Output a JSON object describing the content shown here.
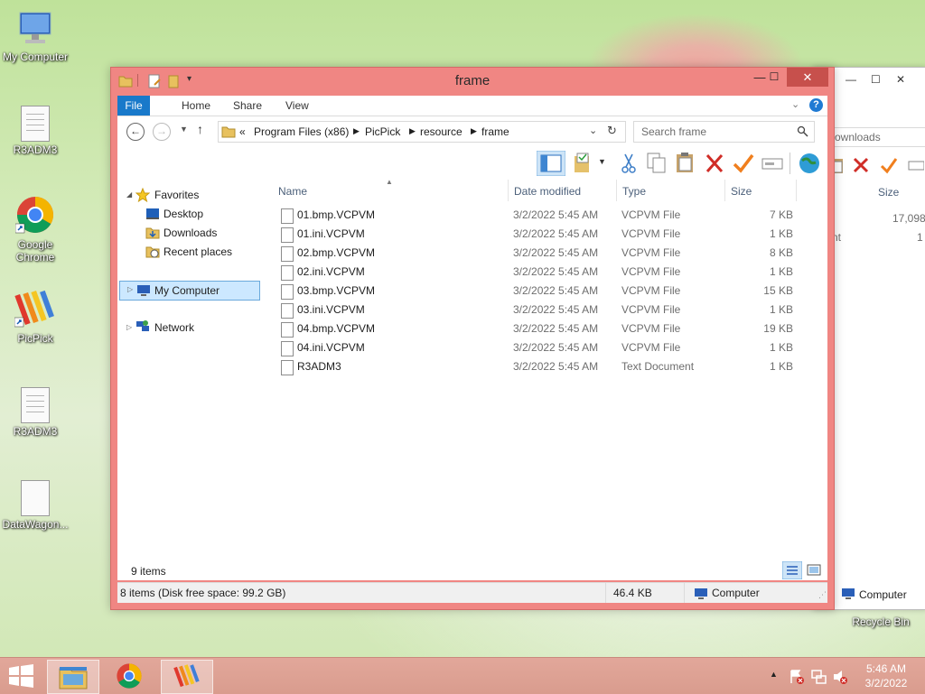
{
  "desktop": {
    "icons": [
      {
        "label": "My Computer"
      },
      {
        "label": "R3ADM3"
      },
      {
        "label": "Google Chrome"
      },
      {
        "label": "PicPick"
      },
      {
        "label": "R3ADM3"
      },
      {
        "label": "DataWagon..."
      },
      {
        "label": "Recycle Bin"
      }
    ]
  },
  "back_window": {
    "address_fragment": "ownloads",
    "col_size": "Size",
    "row1_size": "17,098",
    "row2_fragment": "nt",
    "row2_size": "1",
    "status_computer": "Computer"
  },
  "window": {
    "title": "frame",
    "ribbon_tabs": [
      "File",
      "Home",
      "Share",
      "View"
    ],
    "address": {
      "chevron": "«",
      "crumbs": [
        "Program Files (x86)",
        "PicPick",
        "resource",
        "frame"
      ]
    },
    "search_placeholder": "Search frame",
    "nav": {
      "favorites": "Favorites",
      "desktop": "Desktop",
      "downloads": "Downloads",
      "recent": "Recent places",
      "my_computer": "My Computer",
      "network": "Network"
    },
    "columns": {
      "name": "Name",
      "date": "Date modified",
      "type": "Type",
      "size": "Size"
    },
    "files": [
      {
        "name": "01.bmp.VCPVM",
        "date": "3/2/2022 5:45 AM",
        "type": "VCPVM File",
        "size": "7 KB"
      },
      {
        "name": "01.ini.VCPVM",
        "date": "3/2/2022 5:45 AM",
        "type": "VCPVM File",
        "size": "1 KB"
      },
      {
        "name": "02.bmp.VCPVM",
        "date": "3/2/2022 5:45 AM",
        "type": "VCPVM File",
        "size": "8 KB"
      },
      {
        "name": "02.ini.VCPVM",
        "date": "3/2/2022 5:45 AM",
        "type": "VCPVM File",
        "size": "1 KB"
      },
      {
        "name": "03.bmp.VCPVM",
        "date": "3/2/2022 5:45 AM",
        "type": "VCPVM File",
        "size": "15 KB"
      },
      {
        "name": "03.ini.VCPVM",
        "date": "3/2/2022 5:45 AM",
        "type": "VCPVM File",
        "size": "1 KB"
      },
      {
        "name": "04.bmp.VCPVM",
        "date": "3/2/2022 5:45 AM",
        "type": "VCPVM File",
        "size": "19 KB"
      },
      {
        "name": "04.ini.VCPVM",
        "date": "3/2/2022 5:45 AM",
        "type": "VCPVM File",
        "size": "1 KB"
      },
      {
        "name": "R3ADM3",
        "date": "3/2/2022 5:45 AM",
        "type": "Text Document",
        "size": "1 KB"
      }
    ],
    "item_count": "9 items",
    "status_left": "8 items (Disk free space: 99.2 GB)",
    "status_size": "46.4 KB",
    "status_computer": "Computer"
  },
  "taskbar": {
    "time": "5:46 AM",
    "date": "3/2/2022"
  },
  "colors": {
    "window_frame": "#f08683",
    "accent": "#1979ca",
    "taskbar": "#d99c8e"
  }
}
